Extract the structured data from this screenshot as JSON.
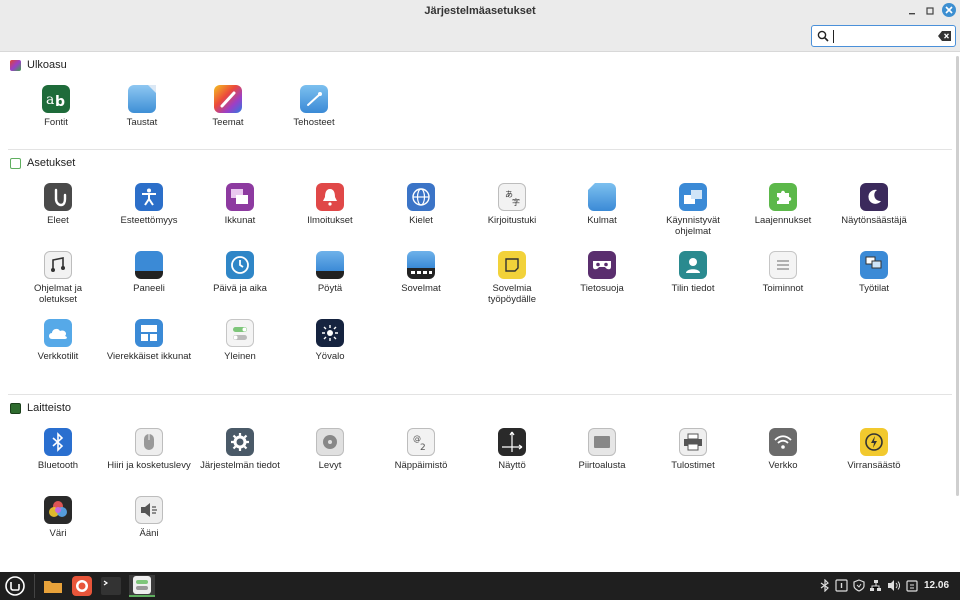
{
  "window": {
    "title": "Järjestelmäasetukset"
  },
  "search": {
    "value": "",
    "placeholder": ""
  },
  "sections": {
    "appearance": {
      "title": "Ulkoasu",
      "items": [
        "Fontit",
        "Taustat",
        "Teemat",
        "Tehosteet"
      ]
    },
    "settings": {
      "title": "Asetukset",
      "items": [
        "Eleet",
        "Esteettömyys",
        "Ikkunat",
        "Ilmoitukset",
        "Kielet",
        "Kirjoitustuki",
        "Kulmat",
        "Käynnistyvät ohjelmat",
        "Laajennukset",
        "Näytönsäästäjä",
        "Ohjelmat ja oletukset",
        "Paneeli",
        "Päivä ja aika",
        "Pöytä",
        "Sovelmat",
        "Sovelmia työpöydälle",
        "Tietosuoja",
        "Tilin tiedot",
        "Toiminnot",
        "Työtilat",
        "Verkkotilit",
        "Vierekkäiset ikkunat",
        "Yleinen",
        "Yövalo"
      ]
    },
    "hardware": {
      "title": "Laitteisto",
      "items": [
        "Bluetooth",
        "Hiiri ja kosketuslevy",
        "Järjestelmän tiedot",
        "Levyt",
        "Näppäimistö",
        "Näyttö",
        "Piirtoalusta",
        "Tulostimet",
        "Verkko",
        "Virransäästö",
        "Väri",
        "Ääni"
      ]
    }
  },
  "taskbar": {
    "clock": "12.06"
  },
  "colors": {
    "accent": "#3d8fd1",
    "taskbar": "#1f1f1f"
  }
}
